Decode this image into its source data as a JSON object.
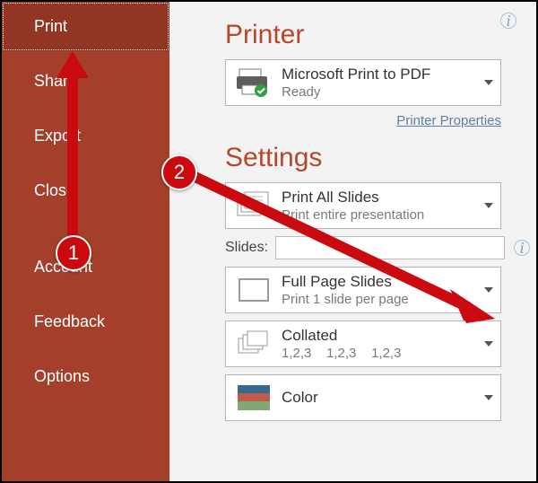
{
  "sidebar": {
    "items": [
      {
        "label": "Print",
        "selected": true
      },
      {
        "label": "Share",
        "selected": false
      },
      {
        "label": "Export",
        "selected": false
      },
      {
        "label": "Close",
        "selected": false
      },
      {
        "label": "Account",
        "selected": false
      },
      {
        "label": "Feedback",
        "selected": false
      },
      {
        "label": "Options",
        "selected": false
      }
    ]
  },
  "printer": {
    "heading": "Printer",
    "device": "Microsoft Print to PDF",
    "status": "Ready",
    "properties_link": "Printer Properties"
  },
  "settings": {
    "heading": "Settings",
    "scope": {
      "title": "Print All Slides",
      "subtitle": "Print entire presentation"
    },
    "slides_label": "Slides:",
    "slides_value": "",
    "layout": {
      "title": "Full Page Slides",
      "subtitle": "Print 1 slide per page"
    },
    "collate": {
      "title": "Collated",
      "subtitle": "1,2,3    1,2,3    1,2,3"
    },
    "color": {
      "title": "Color"
    }
  },
  "annotations": {
    "badge1": "1",
    "badge2": "2"
  }
}
